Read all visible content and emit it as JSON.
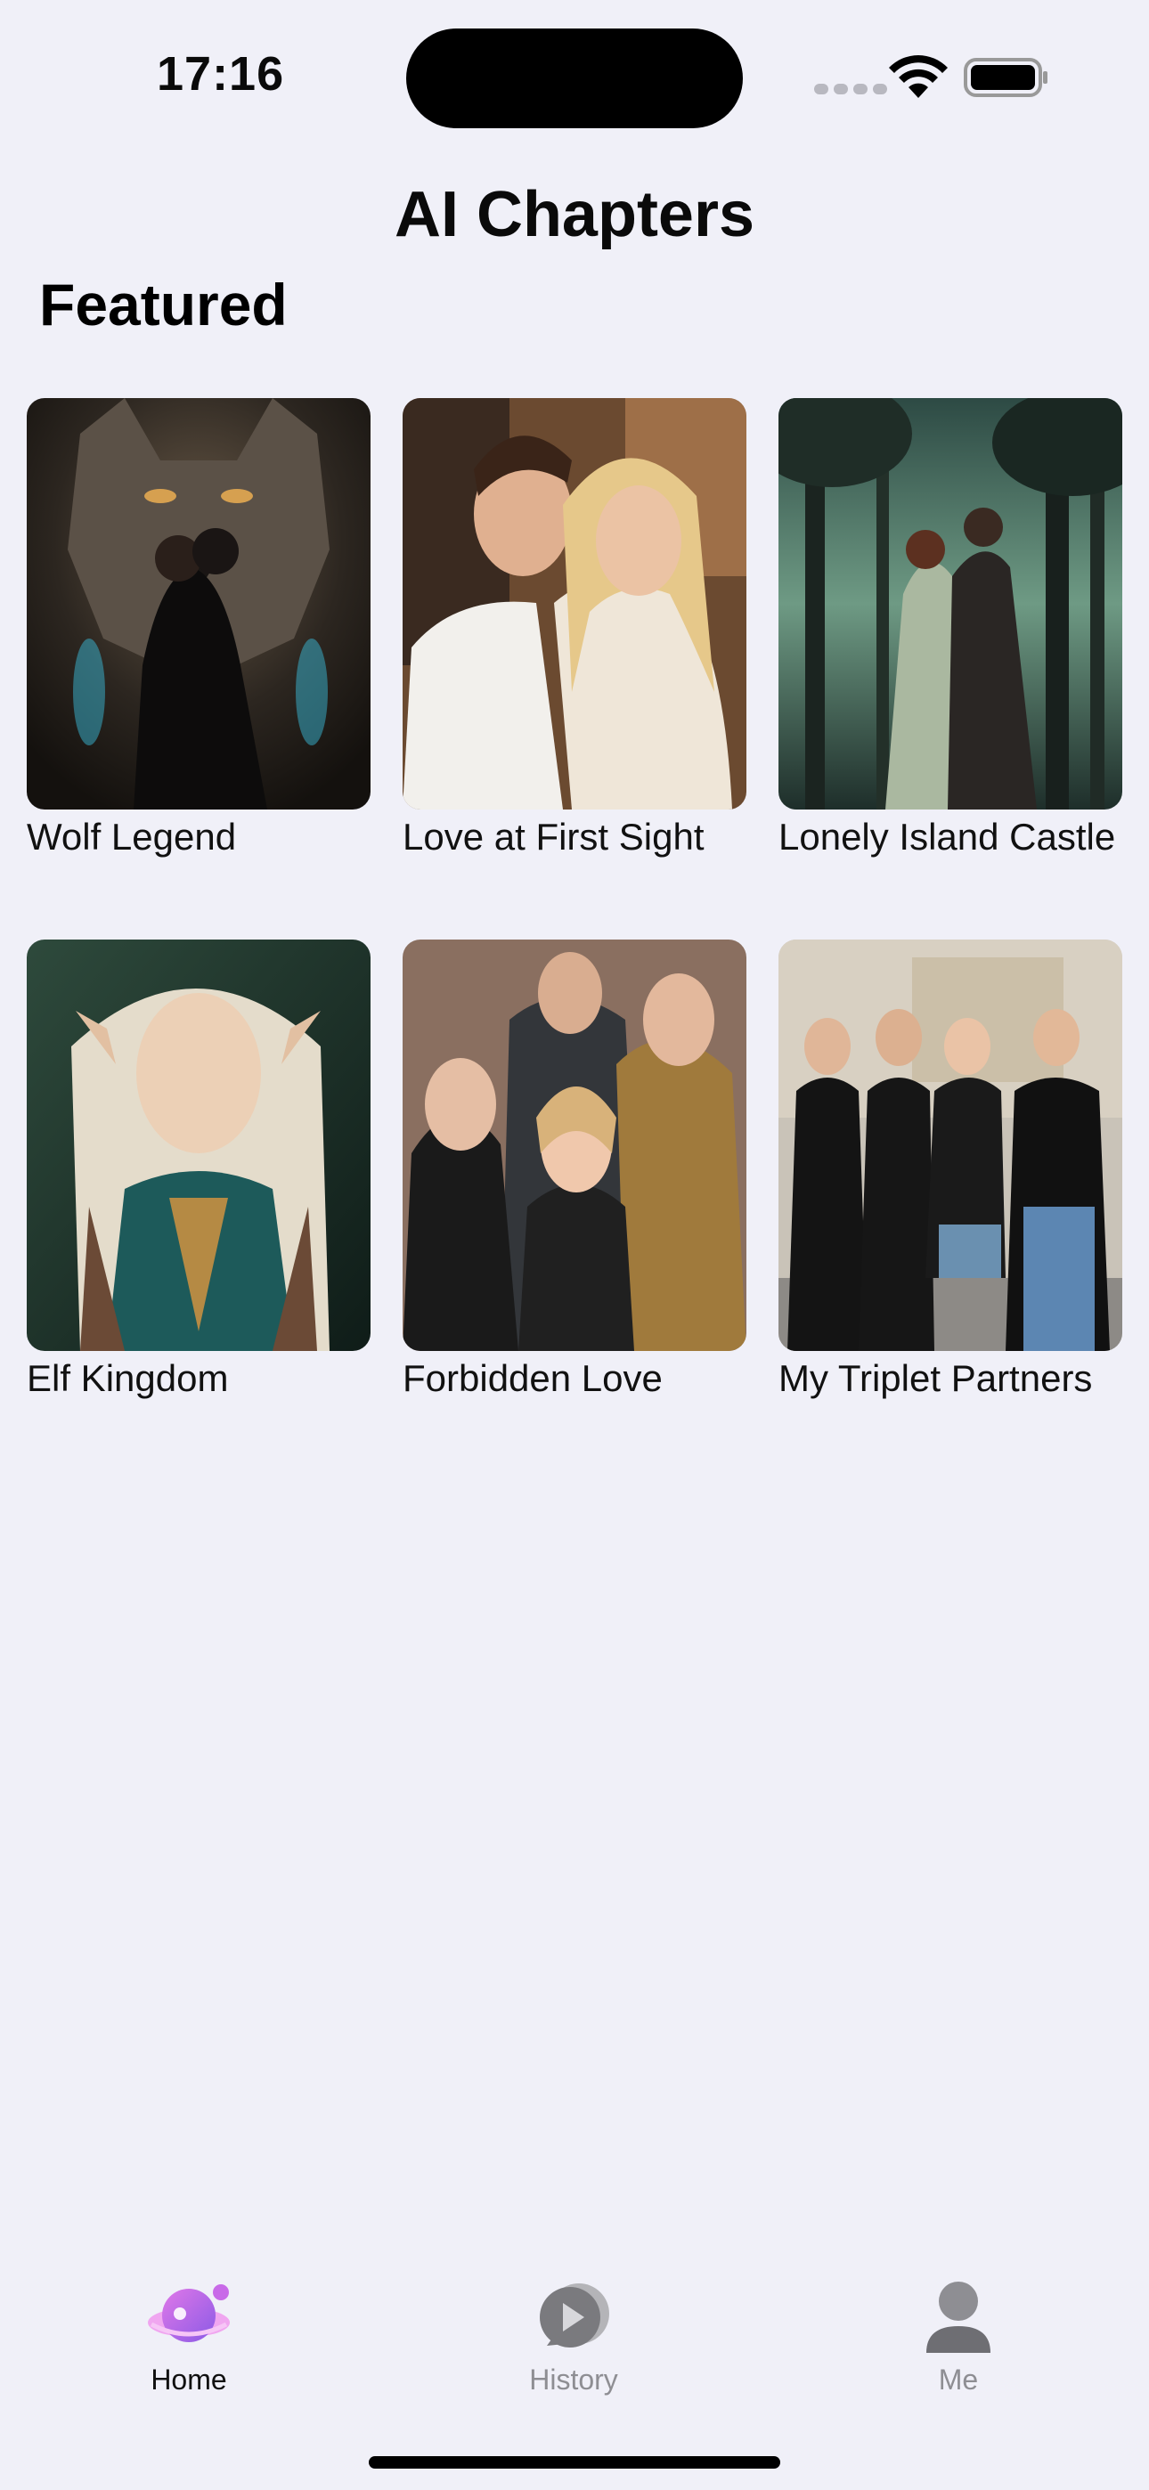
{
  "status_bar": {
    "time": "17:16"
  },
  "header": {
    "title": "AI Chapters"
  },
  "featured": {
    "section_title": "Featured",
    "stories": [
      {
        "title": "Wolf Legend",
        "cover": "wolf-couple-cover"
      },
      {
        "title": "Love at First Sight",
        "cover": "embracing-couple-cover"
      },
      {
        "title": "Lonely Island Castle",
        "cover": "forest-kiss-cover"
      },
      {
        "title": "Elf Kingdom",
        "cover": "elf-portrait-cover"
      },
      {
        "title": "Forbidden Love",
        "cover": "group-portrait-cover"
      },
      {
        "title": "My Triplet Partners",
        "cover": "campus-group-cover"
      }
    ]
  },
  "tab_bar": {
    "tabs": [
      {
        "label": "Home",
        "icon": "planet-icon",
        "selected": true
      },
      {
        "label": "History",
        "icon": "play-bubble-icon",
        "selected": false
      },
      {
        "label": "Me",
        "icon": "person-icon",
        "selected": false
      }
    ]
  },
  "colors": {
    "background": "#f0f0f8",
    "accent": "#c35ce6",
    "tab_inactive": "#8e8e93",
    "tab_active": "#111111"
  }
}
